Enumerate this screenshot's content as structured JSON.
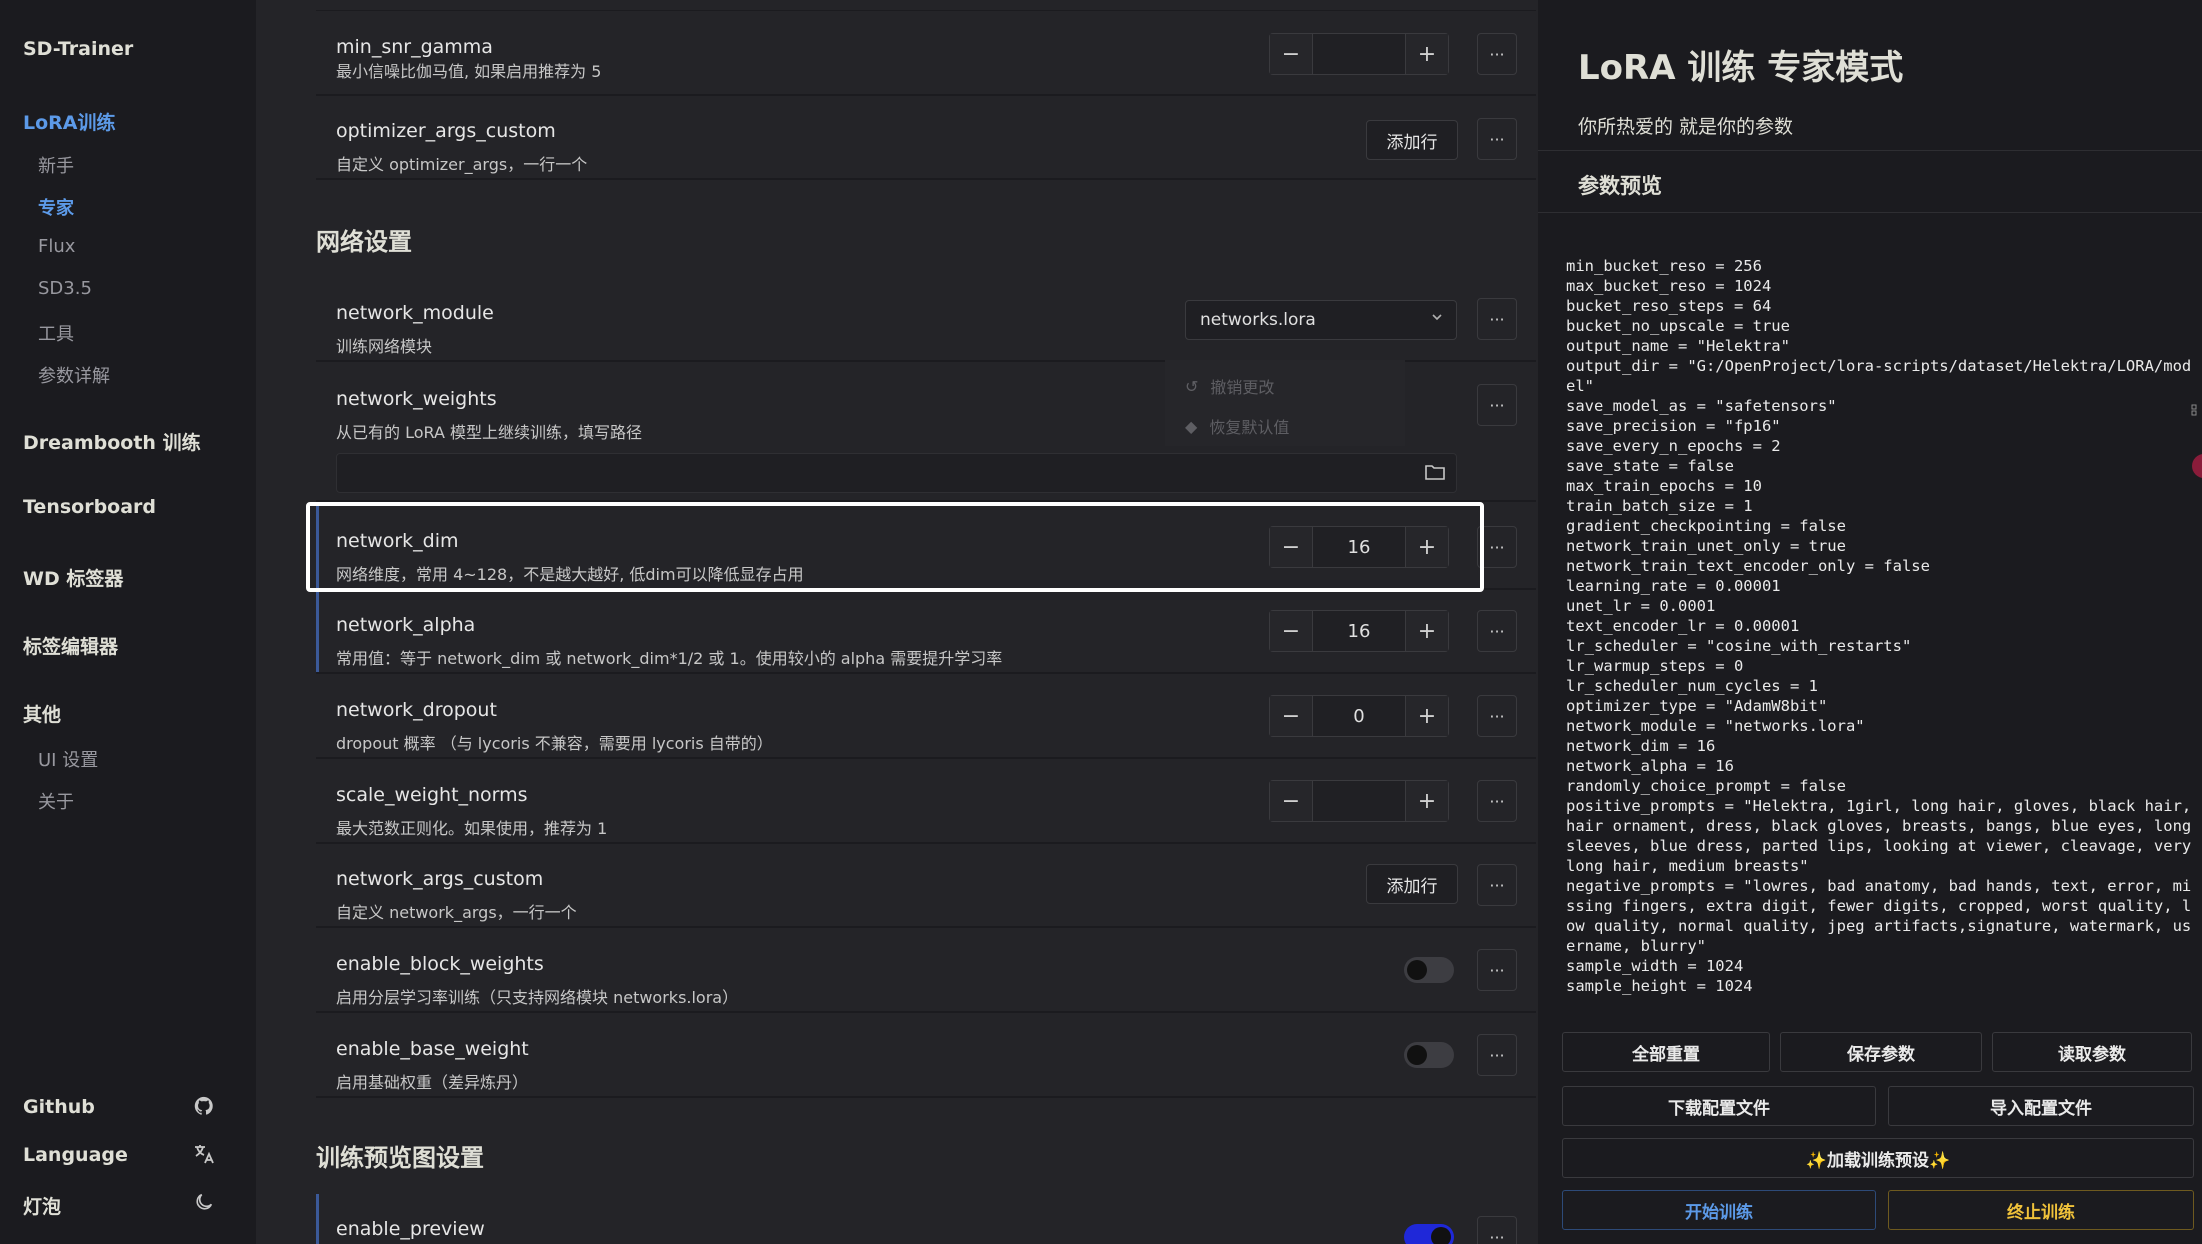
{
  "sidebar": {
    "brand": "SD-Trainer",
    "lora_group": "LoRA训练",
    "lora_items": [
      "新手",
      "专家",
      "Flux",
      "SD3.5",
      "工具",
      "参数详解"
    ],
    "groups": [
      "Dreambooth 训练",
      "Tensorboard",
      "WD 标签器",
      "标签编辑器",
      "其他"
    ],
    "other_items": [
      "UI 设置",
      "关于"
    ],
    "footer": [
      {
        "label": "Github",
        "icon": "github-icon"
      },
      {
        "label": "Language",
        "icon": "translate-icon"
      },
      {
        "label": "灯泡",
        "icon": "moon-icon"
      }
    ]
  },
  "main": {
    "rows_top": [
      {
        "name": "min_snr_gamma",
        "desc": "最小信噪比伽马值, 如果启用推荐为 5",
        "control": "stepper",
        "value": ""
      },
      {
        "name": "optimizer_args_custom",
        "desc": "自定义 optimizer_args，一行一个",
        "control": "addrow",
        "button": "添加行"
      }
    ],
    "section_network": "网络设置",
    "network_module": {
      "name": "network_module",
      "desc": "训练网络模块",
      "value": "networks.lora"
    },
    "network_weights": {
      "name": "network_weights",
      "desc": "从已有的 LoRA 模型上继续训练，填写路径"
    },
    "context_menu": {
      "undo": "撤销更改",
      "reset": "恢复默认值"
    },
    "rows_network": [
      {
        "name": "network_dim",
        "desc": "网络维度，常用 4~128，不是越大越好, 低dim可以降低显存占用",
        "control": "stepper",
        "value": "16"
      },
      {
        "name": "network_alpha",
        "desc": "常用值：等于 network_dim 或 network_dim*1/2 或 1。使用较小的 alpha 需要提升学习率",
        "control": "stepper",
        "value": "16"
      },
      {
        "name": "network_dropout",
        "desc": "dropout 概率 （与 lycoris 不兼容，需要用 lycoris 自带的）",
        "control": "stepper",
        "value": "0"
      },
      {
        "name": "scale_weight_norms",
        "desc": "最大范数正则化。如果使用，推荐为 1",
        "control": "stepper",
        "value": ""
      },
      {
        "name": "network_args_custom",
        "desc": "自定义 network_args，一行一个",
        "control": "addrow",
        "button": "添加行"
      },
      {
        "name": "enable_block_weights",
        "desc": "启用分层学习率训练（只支持网络模块 networks.lora）",
        "control": "toggle",
        "on": false
      },
      {
        "name": "enable_base_weight",
        "desc": "启用基础权重（差异炼丹）",
        "control": "toggle",
        "on": false
      }
    ],
    "section_preview": "训练预览图设置",
    "enable_preview": {
      "name": "enable_preview",
      "on": true
    }
  },
  "right": {
    "title": "LoRA 训练 专家模式",
    "subtitle": "你所热爱的 就是你的参数",
    "preview_label": "参数预览",
    "toml": "min_bucket_reso = 256\nmax_bucket_reso = 1024\nbucket_reso_steps = 64\nbucket_no_upscale = true\noutput_name = \"Helektra\"\noutput_dir = \"G:/OpenProject/lora-scripts/dataset/Helektra/LORA/model\"\nsave_model_as = \"safetensors\"\nsave_precision = \"fp16\"\nsave_every_n_epochs = 2\nsave_state = false\nmax_train_epochs = 10\ntrain_batch_size = 1\ngradient_checkpointing = false\nnetwork_train_unet_only = true\nnetwork_train_text_encoder_only = false\nlearning_rate = 0.00001\nunet_lr = 0.0001\ntext_encoder_lr = 0.00001\nlr_scheduler = \"cosine_with_restarts\"\nlr_warmup_steps = 0\nlr_scheduler_num_cycles = 1\noptimizer_type = \"AdamW8bit\"\nnetwork_module = \"networks.lora\"\nnetwork_dim = 16\nnetwork_alpha = 16\nrandomly_choice_prompt = false\npositive_prompts = \"Helektra, 1girl, long hair, gloves, black hair, hair ornament, dress, black gloves, breasts, bangs, blue eyes, long sleeves, blue dress, parted lips, looking at viewer, cleavage, very long hair, medium breasts\"\nnegative_prompts = \"lowres, bad anatomy, bad hands, text, error, missing fingers, extra digit, fewer digits, cropped, worst quality, low quality, normal quality, jpeg artifacts,signature, watermark, username, blurry\"\nsample_width = 1024\nsample_height = 1024",
    "buttons": {
      "reset_all": "全部重置",
      "save_params": "保存参数",
      "load_params": "读取参数",
      "download_config": "下载配置文件",
      "import_config": "导入配置文件",
      "load_preset": "✨加载训练预设✨",
      "start": "开始训练",
      "stop": "终止训练"
    }
  }
}
